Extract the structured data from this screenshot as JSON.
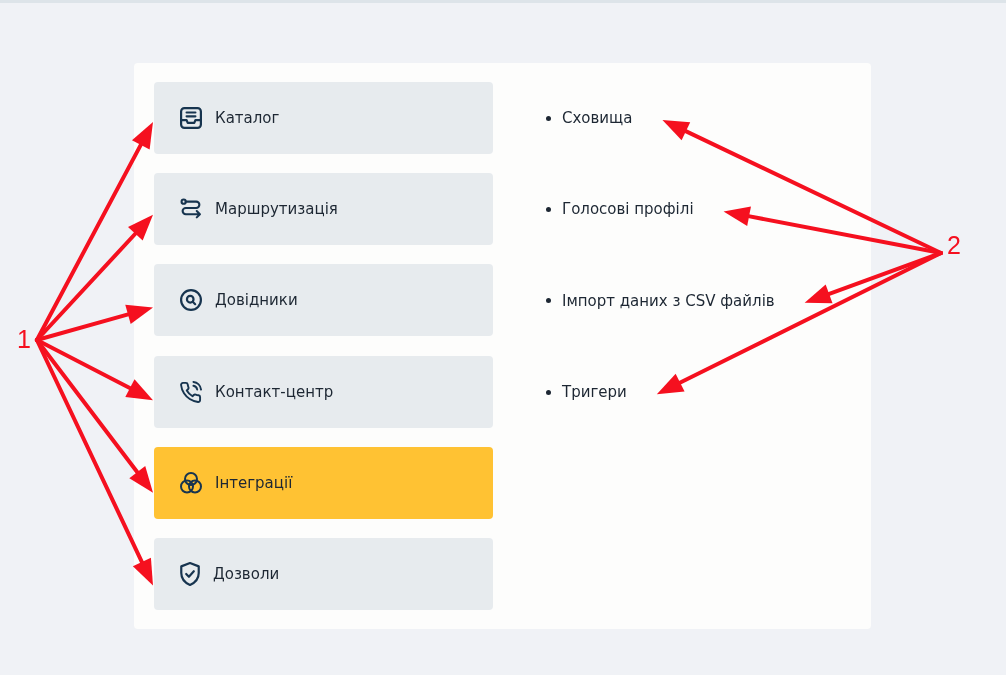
{
  "menu": [
    {
      "label": "Каталог",
      "selected": false
    },
    {
      "label": "Маршрутизація",
      "selected": false
    },
    {
      "label": "Довідники",
      "selected": false
    },
    {
      "label": "Контакт-центр",
      "selected": false
    },
    {
      "label": "Інтеграції",
      "selected": true
    },
    {
      "label": "Дозволи",
      "selected": false
    }
  ],
  "submenu": [
    {
      "label": "Сховища"
    },
    {
      "label": "Голосові профілі"
    },
    {
      "label": "Імпорт даних з CSV файлів"
    },
    {
      "label": "Тригери"
    }
  ],
  "callouts": [
    {
      "label": "1",
      "kind": "menu"
    },
    {
      "label": "2",
      "kind": "submenu"
    }
  ]
}
